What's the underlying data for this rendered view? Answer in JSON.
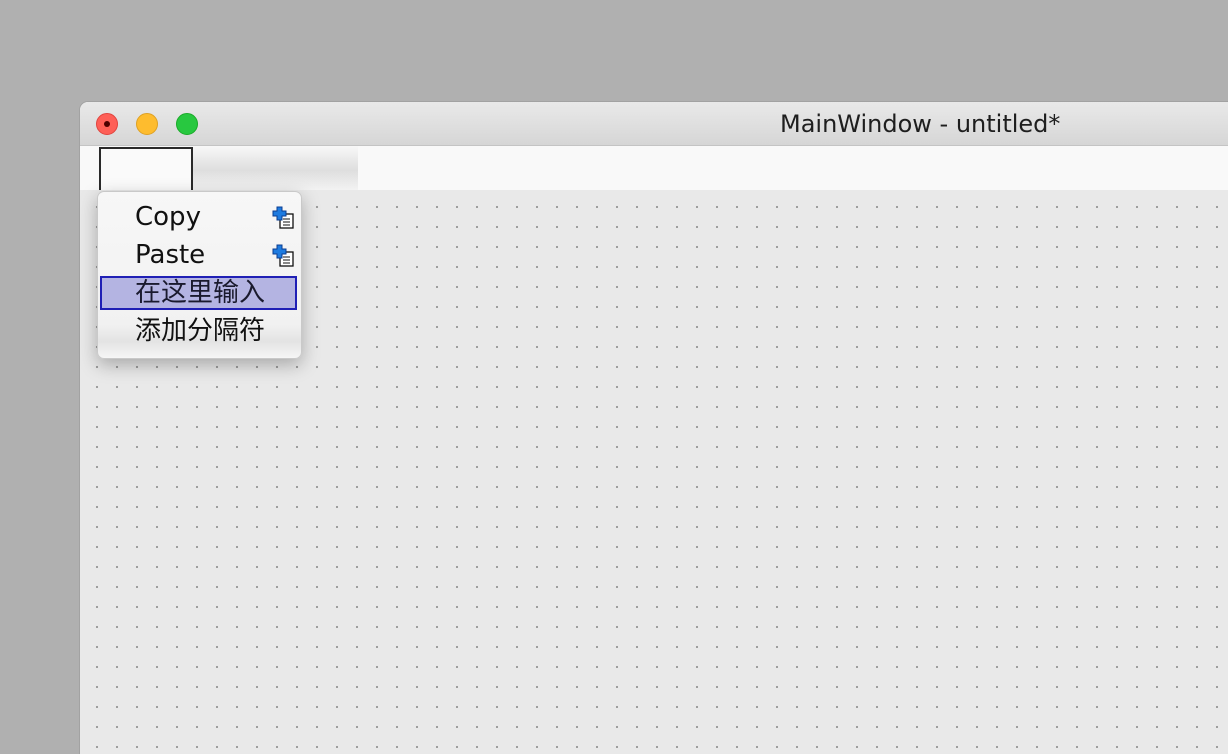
{
  "window": {
    "title": "MainWindow - untitled*"
  },
  "context_menu": {
    "items": [
      {
        "label": "Copy",
        "icon": "copy-icon"
      },
      {
        "label": "Paste",
        "icon": "paste-icon"
      },
      {
        "label": "在这里输入",
        "highlighted": true
      },
      {
        "label": "添加分隔符"
      }
    ]
  },
  "colors": {
    "highlight_fill": "#b4b4e2",
    "highlight_border": "#1f1fb5",
    "close": "#fe5f57",
    "minimize": "#febc2e",
    "zoom": "#28c840"
  }
}
